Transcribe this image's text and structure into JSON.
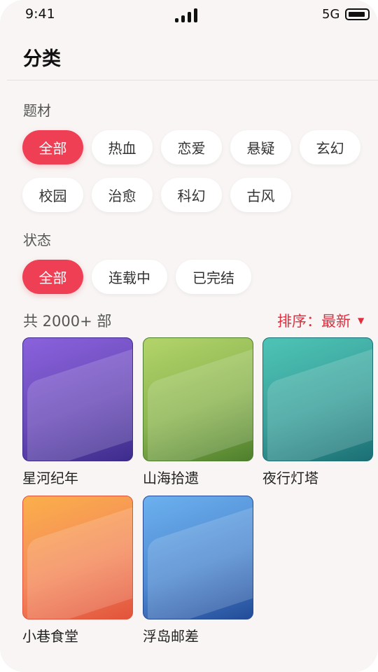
{
  "status_bar": {
    "time": "9:41",
    "network": "5G"
  },
  "header": {
    "title": "分类"
  },
  "genre": {
    "label": "题材",
    "chips": [
      "全部",
      "热血",
      "恋爱",
      "悬疑",
      "玄幻",
      "校园",
      "治愈",
      "科幻",
      "古风"
    ],
    "selected": "全部"
  },
  "status_filter": {
    "label": "状态",
    "chips": [
      "全部",
      "连载中",
      "已完结"
    ],
    "selected": "全部"
  },
  "results": {
    "count_text": "共 2000+ 部",
    "sort_text": "排序：最新",
    "sort_caret": "▼"
  },
  "books": [
    {
      "title": "星河纪年",
      "color": "#6a4ab8"
    },
    {
      "title": "山海拾遗",
      "color": "#8cb551"
    },
    {
      "title": "夜行灯塔",
      "color": "#3aa09b"
    },
    {
      "title": "小巷食堂",
      "color": "#f48a5b"
    },
    {
      "title": "浮岛邮差",
      "color": "#4f8ad1"
    }
  ]
}
